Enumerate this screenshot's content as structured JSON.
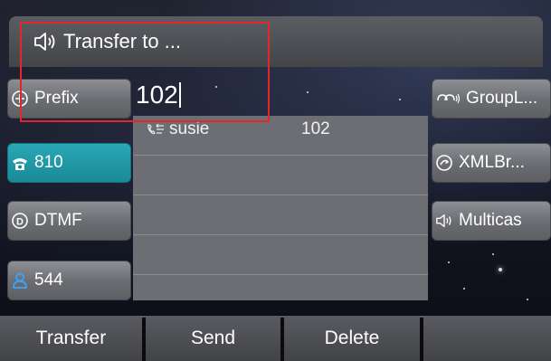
{
  "title_bar": {
    "title": "Transfer to ...",
    "icon": "speaker-icon"
  },
  "input": {
    "value": "102"
  },
  "left_keys": [
    {
      "label": "Prefix",
      "icon": "plus-circle-icon"
    },
    {
      "label": "810",
      "icon": "phone-icon",
      "active": true
    },
    {
      "label": "DTMF",
      "icon": "dtmf-icon"
    },
    {
      "label": "544",
      "icon": "user-icon"
    }
  ],
  "right_keys": [
    {
      "label": "GroupL...",
      "icon": "group-listen-icon"
    },
    {
      "label": "XMLBr...",
      "icon": "xml-browser-icon"
    },
    {
      "label": "Multicas",
      "icon": "multicast-speaker-icon"
    }
  ],
  "directory": [
    {
      "name": "susie",
      "number": "102",
      "icon": "call-history-icon"
    }
  ],
  "softkeys": {
    "transfer": "Transfer",
    "send": "Send",
    "delete": "Delete",
    "empty": ""
  },
  "colors": {
    "highlight_border": "#e2262c",
    "active_key": "#1a8b98"
  }
}
